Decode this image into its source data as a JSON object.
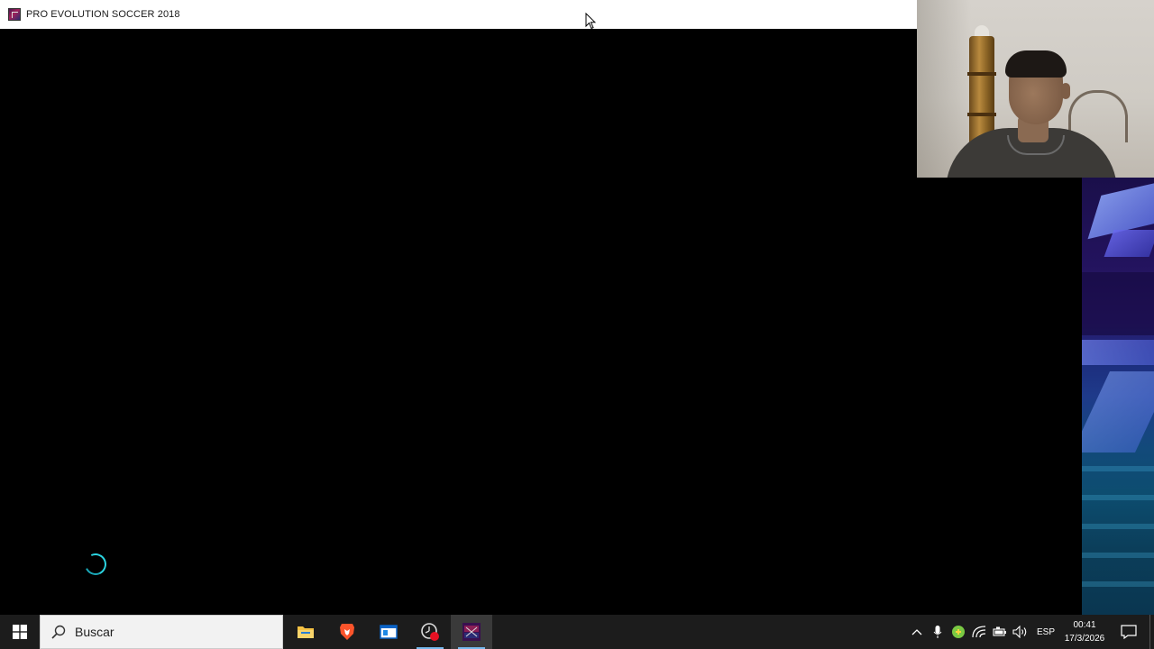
{
  "window": {
    "title": "PRO EVOLUTION SOCCER 2018",
    "icon": "pes2018-app-icon"
  },
  "game": {
    "loading_indicator": "loading-spinner-icon",
    "accent_color": "#2bd3e0"
  },
  "taskbar": {
    "start_icon": "windows-start-icon",
    "search": {
      "placeholder": "Buscar"
    },
    "apps": [
      {
        "name": "File Explorer",
        "icon": "folder-icon"
      },
      {
        "name": "Brave",
        "icon": "brave-lion-icon"
      },
      {
        "name": "Window app",
        "icon": "window-app-icon"
      },
      {
        "name": "Recorder",
        "icon": "record-clock-icon"
      },
      {
        "name": "PRO EVOLUTION SOCCER 2018",
        "icon": "pes2018-app-icon"
      }
    ],
    "tray": {
      "language": "ESP",
      "time": "00:41",
      "date": "17/3/2026",
      "icons": [
        "chevron-up-icon",
        "microphone-icon",
        "green-status-icon",
        "wifi-icon",
        "battery-icon",
        "speaker-icon",
        "notification-icon"
      ]
    },
    "background": "#1c1c1c",
    "running_indicator_color": "#76b9ed"
  }
}
